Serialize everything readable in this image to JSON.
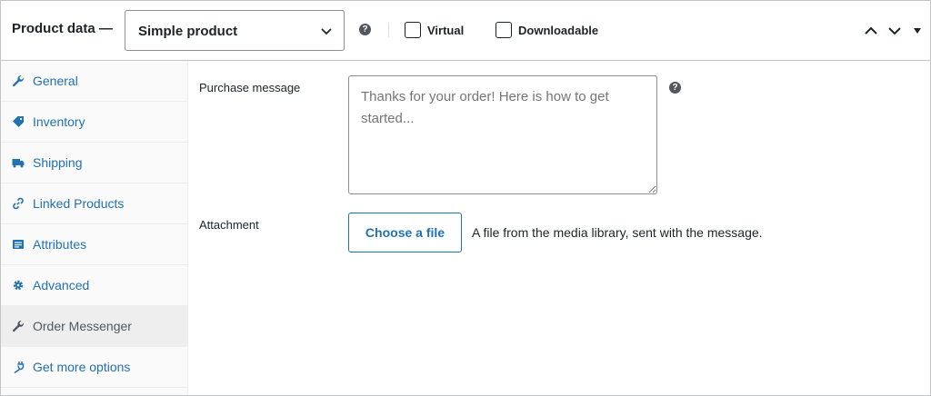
{
  "header": {
    "title": "Product data —",
    "product_type": "Simple product",
    "virtual_label": "Virtual",
    "downloadable_label": "Downloadable",
    "help_glyph": "?"
  },
  "sidebar": {
    "items": [
      {
        "label": "General",
        "icon": "wrench-icon",
        "active": false
      },
      {
        "label": "Inventory",
        "icon": "tag-icon",
        "active": false
      },
      {
        "label": "Shipping",
        "icon": "truck-icon",
        "active": false
      },
      {
        "label": "Linked Products",
        "icon": "link-icon",
        "active": false
      },
      {
        "label": "Attributes",
        "icon": "list-icon",
        "active": false
      },
      {
        "label": "Advanced",
        "icon": "gear-icon",
        "active": false
      },
      {
        "label": "Order Messenger",
        "icon": "wrench-icon",
        "active": true
      },
      {
        "label": "Get more options",
        "icon": "plug-icon",
        "active": false
      }
    ]
  },
  "main": {
    "purchase_message_label": "Purchase message",
    "purchase_message_placeholder": "Thanks for your order! Here is how to get started...",
    "attachment_label": "Attachment",
    "choose_file_label": "Choose a file",
    "attachment_description": "A file from the media library, sent with the message."
  },
  "colors": {
    "link": "#2271b1",
    "active_bg": "#eeeeee",
    "sidebar_bg": "#fafafa",
    "border": "#c3c4c7"
  }
}
